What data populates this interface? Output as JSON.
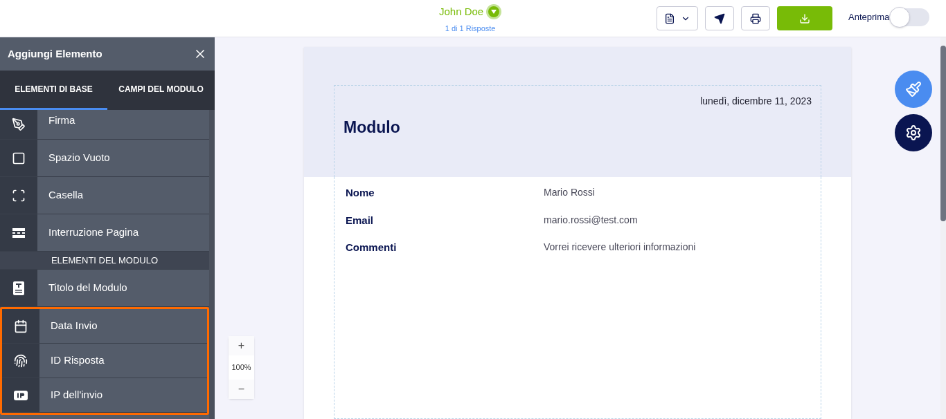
{
  "header": {
    "name": "John Doe",
    "subtitle": "1 di 1 Risposte",
    "preview": {
      "label": "Anteprima",
      "on": false
    }
  },
  "sidebar": {
    "title": "Aggiungi Elemento",
    "tabs": [
      {
        "label": "ELEMENTI DI BASE",
        "selected": true
      },
      {
        "label": "CAMPI DEL MODULO",
        "selected": false
      }
    ],
    "items": [
      {
        "kind": "item",
        "label": "Firma",
        "highlighted": false
      },
      {
        "kind": "item",
        "label": "Spazio Vuoto",
        "highlighted": false
      },
      {
        "kind": "item",
        "label": "Casella",
        "highlighted": false
      },
      {
        "kind": "item",
        "label": "Interruzione Pagina",
        "highlighted": false
      },
      {
        "kind": "section",
        "label": "ELEMENTI DEL MODULO",
        "highlighted": false
      },
      {
        "kind": "item",
        "label": "Titolo del Modulo",
        "highlighted": false
      },
      {
        "kind": "item",
        "label": "Data Invio",
        "highlighted": true
      },
      {
        "kind": "item",
        "label": "ID Risposta",
        "highlighted": true
      },
      {
        "kind": "item",
        "label": "IP dell'invio",
        "highlighted": true
      }
    ]
  },
  "zoom": {
    "plus": "+",
    "level": "100%",
    "minus": "−"
  },
  "document": {
    "date": "lunedì, dicembre 11, 2023",
    "title": "Modulo",
    "fields": [
      {
        "label": "Nome",
        "value": "Mario Rossi"
      },
      {
        "label": "Email",
        "value": "mario.rossi@test.com"
      },
      {
        "label": "Commenti",
        "value": "Vorrei ricevere ulteriori informazioni"
      }
    ]
  }
}
